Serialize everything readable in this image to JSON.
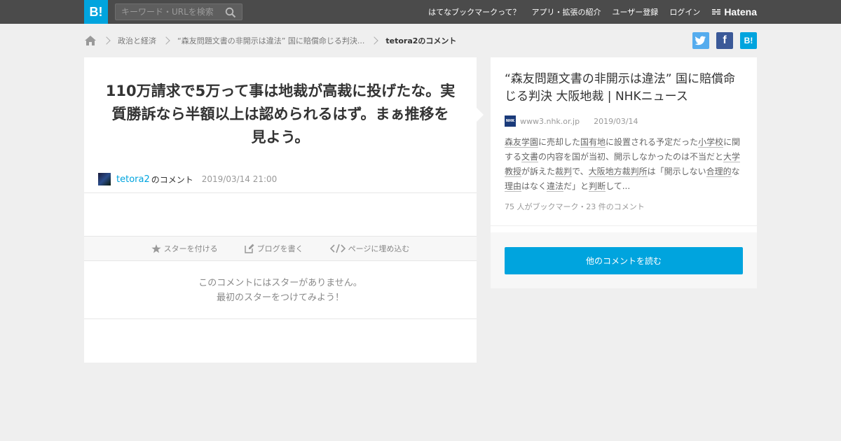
{
  "header": {
    "logo": "B!",
    "search_placeholder": "キーワード・URLを検索",
    "nav": [
      "はてなブックマークって？",
      "アプリ・拡張の紹介",
      "ユーザー登録",
      "ログイン"
    ],
    "brand": "Hatena"
  },
  "breadcrumb": {
    "items": [
      "政治と経済",
      "“森友問題文書の非開示は違法” 国に賠償命じる判決...",
      "tetora2のコメント"
    ]
  },
  "share": {
    "facebook": "f",
    "hatena": "B!"
  },
  "comment": {
    "text": "110万請求で5万って事は地裁が高裁に投げたな。実質勝訴なら半額以上は認められるはず。まぁ推移を見よう。",
    "user": "tetora2",
    "user_suffix": "のコメント",
    "date": "2019/03/14 21:00"
  },
  "actions": {
    "star": "スターを付ける",
    "blog": "ブログを書く",
    "embed": "ページに埋め込む"
  },
  "no_star": {
    "line1": "このコメントにはスターがありません。",
    "line2": "最初のスターをつけてみよう！"
  },
  "entry": {
    "title": "“森友問題文書の非開示は違法” 国に賠償命じる判決 大阪地裁 | NHKニュース",
    "favicon_text": "NHK",
    "domain": "www3.nhk.or.jp",
    "date": "2019/03/14",
    "summary_parts": [
      {
        "t": "森友学園",
        "u": true
      },
      {
        "t": "に売却した",
        "u": false
      },
      {
        "t": "国有地",
        "u": true
      },
      {
        "t": "に設置される予定だった",
        "u": false
      },
      {
        "t": "小学校",
        "u": true
      },
      {
        "t": "に関する",
        "u": false
      },
      {
        "t": "文書",
        "u": true
      },
      {
        "t": "の内容を国が当初、開示しなかったのは不当だと",
        "u": false
      },
      {
        "t": "大学教授",
        "u": true
      },
      {
        "t": "が訴えた",
        "u": false
      },
      {
        "t": "裁判",
        "u": true
      },
      {
        "t": "で、",
        "u": false
      },
      {
        "t": "大阪地方裁判所",
        "u": true
      },
      {
        "t": "は「開示しない",
        "u": false
      },
      {
        "t": "合理的",
        "u": true
      },
      {
        "t": "な",
        "u": false
      },
      {
        "t": "理由",
        "u": true
      },
      {
        "t": "はなく",
        "u": false
      },
      {
        "t": "違法",
        "u": true
      },
      {
        "t": "だ」と",
        "u": false
      },
      {
        "t": "判断",
        "u": true
      },
      {
        "t": "して...",
        "u": false
      }
    ],
    "counts": "75 人がブックマーク・23 件のコメント",
    "more_button": "他のコメントを読む"
  }
}
